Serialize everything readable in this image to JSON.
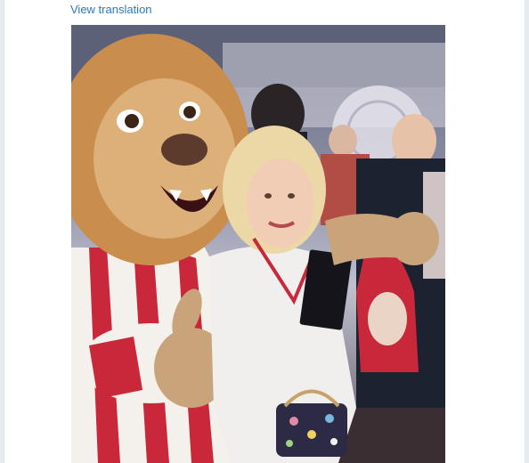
{
  "tweet": {
    "view_translation_label": "View translation",
    "photo_alt": "Photo of a woman posing with a lion mascot wearing a red and white striped jersey"
  }
}
